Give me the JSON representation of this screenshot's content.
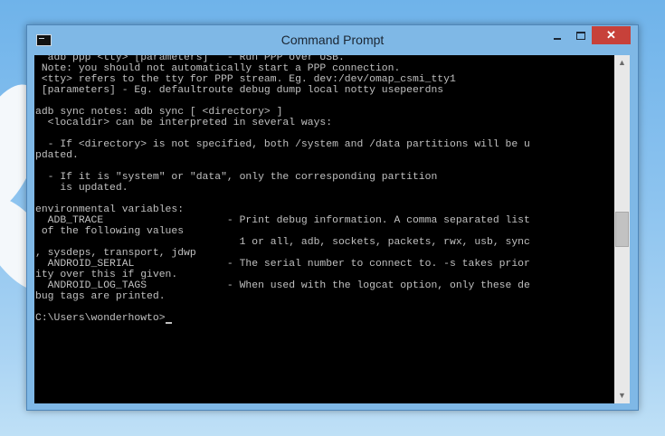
{
  "window": {
    "title": "Command Prompt",
    "icon": "cmd-icon",
    "controls": {
      "minimize": "minimize-icon",
      "maximize": "maximize-icon",
      "close": "✕"
    }
  },
  "console": {
    "lines": [
      "  adb ppp <tty> [parameters]   - Run PPP over USB.",
      " Note: you should not automatically start a PPP connection.",
      " <tty> refers to the tty for PPP stream. Eg. dev:/dev/omap_csmi_tty1",
      " [parameters] - Eg. defaultroute debug dump local notty usepeerdns",
      "",
      "adb sync notes: adb sync [ <directory> ]",
      "  <localdir> can be interpreted in several ways:",
      "",
      "  - If <directory> is not specified, both /system and /data partitions will be u",
      "pdated.",
      "",
      "  - If it is \"system\" or \"data\", only the corresponding partition",
      "    is updated.",
      "",
      "environmental variables:",
      "  ADB_TRACE                    - Print debug information. A comma separated list",
      " of the following values",
      "                                 1 or all, adb, sockets, packets, rwx, usb, sync",
      ", sysdeps, transport, jdwp",
      "  ANDROID_SERIAL               - The serial number to connect to. -s takes prior",
      "ity over this if given.",
      "  ANDROID_LOG_TAGS             - When used with the logcat option, only these de",
      "bug tags are printed.",
      ""
    ],
    "prompt": "C:\\Users\\wonderhowto>"
  },
  "scrollbar": {
    "up": "▲",
    "down": "▼",
    "position": 0.5
  }
}
